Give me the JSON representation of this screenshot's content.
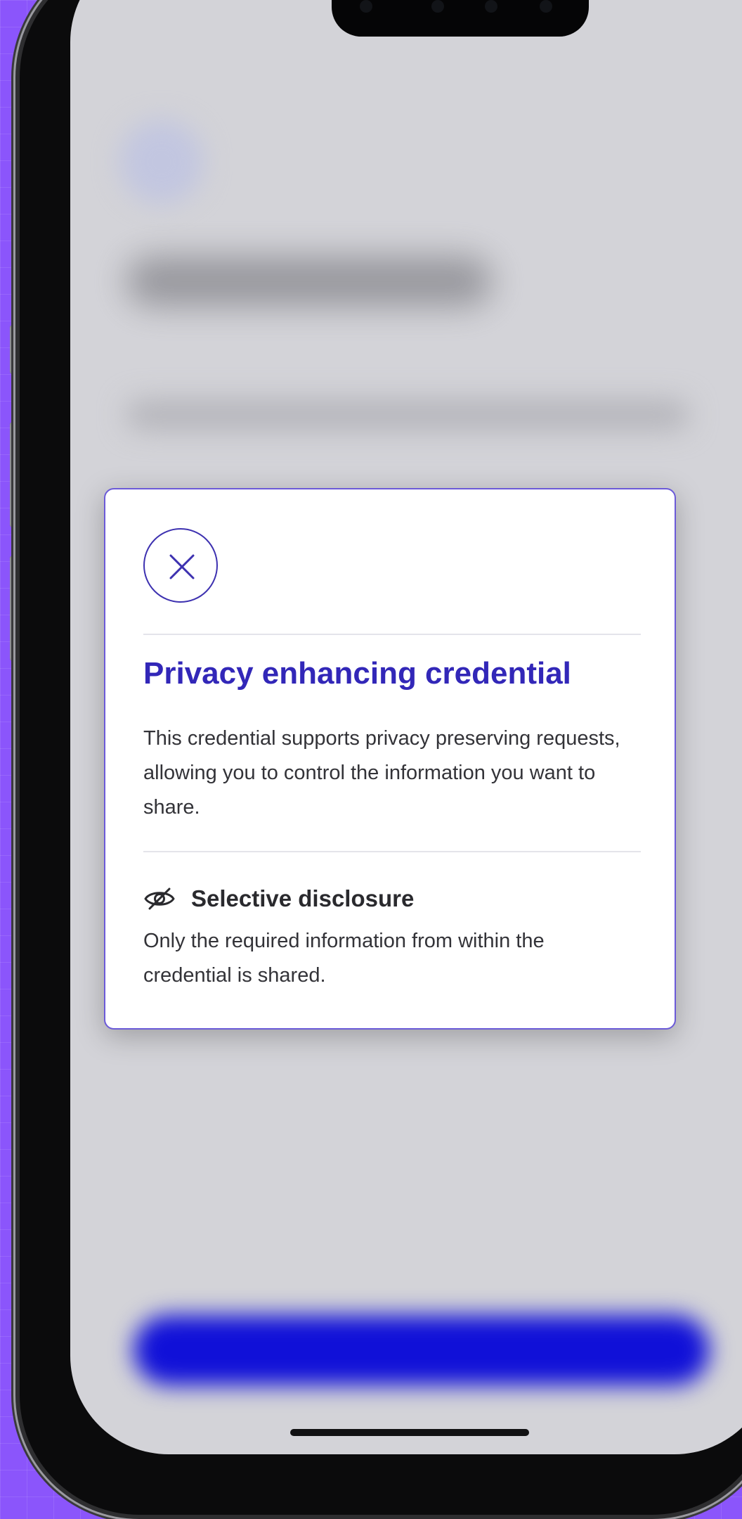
{
  "modal": {
    "title": "Privacy enhancing credential",
    "description": "This credential supports privacy preserving requests, allowing you to control the information you want to share.",
    "feature": {
      "icon": "eye-slash-icon",
      "title": "Selective disclosure",
      "description": "Only the required information from within the credential is shared."
    },
    "close_icon": "close-icon"
  },
  "colors": {
    "background": "#8b55fb",
    "screen": "#d3d3d8",
    "accent": "#3227b8",
    "modal_border": "#6b5ad8",
    "cta_blurred": "#1010d8"
  }
}
